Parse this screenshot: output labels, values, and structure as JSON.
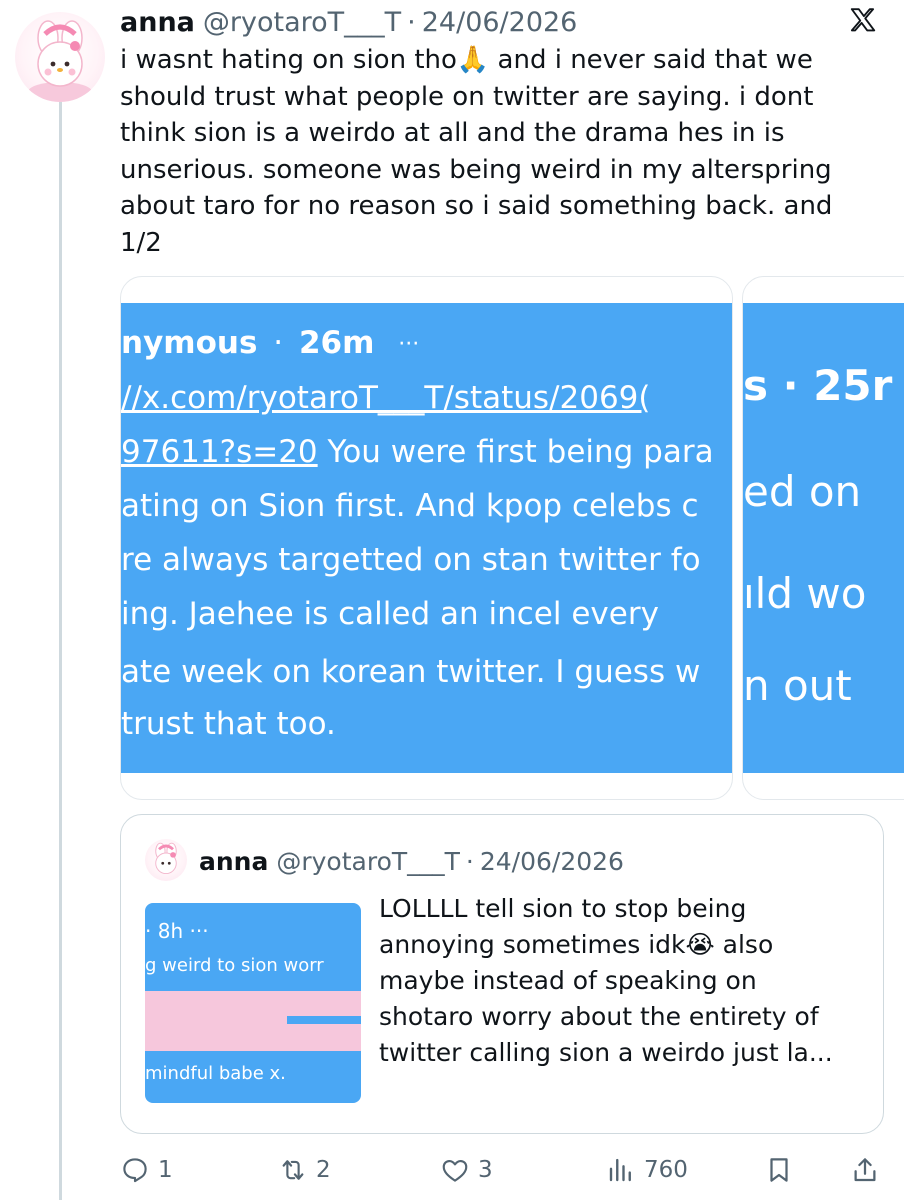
{
  "tweet": {
    "author_name": "anna",
    "handle": "@ryotaroT___T",
    "separator": "·",
    "date": "24/06/2026",
    "text": "i wasnt hating on sion tho🙏 and i never said that we\nshould trust what people on twitter are saying. i dont\nthink sion is a weirdo at all and the drama hes in is\nunserious. someone was being weird in my alterspring\nabout taro for no reason so i said something back. and\n1/2"
  },
  "media": {
    "image1": {
      "header_name": "nymous",
      "header_sep": "·",
      "header_time": "26m",
      "header_more": "···",
      "link_part1": "//x.com/ryotaroT___T/status/2069(",
      "link_part2": "97611?s=20",
      "line2_rest": " You were first being para",
      "line3": "ating on Sion first. And kpop celebs c",
      "line4": "re always targetted on stan twitter fo",
      "line5": "ing. Jaehee is called an incel every",
      "line6": "ate week on korean twitter. I guess w",
      "line7": " trust that too."
    },
    "image2": {
      "line1": "s · 25r",
      "line2": "ed on",
      "line3": "ıld wo",
      "line4": "n out"
    }
  },
  "quote": {
    "author_name": "anna",
    "handle": "@ryotaroT___T",
    "separator": "·",
    "date": "24/06/2026",
    "text": "LOLLLL tell sion to stop being\nannoying sometimes idk😭 also\nmaybe instead of speaking on\nshotaro worry about the entirety of\ntwitter calling sion a weirdo just la...",
    "thumb": {
      "header": "· 8h ···",
      "line1": "g weird to sion worr",
      "line2": "mindful babe x."
    }
  },
  "actions": {
    "replies": "1",
    "reposts": "2",
    "likes": "3",
    "views": "760"
  },
  "icons": {
    "x_logo": "x-logo-icon",
    "reply": "reply-icon",
    "repost": "repost-icon",
    "like": "heart-icon",
    "views": "views-chart-icon",
    "bookmark": "bookmark-icon",
    "share": "share-icon"
  },
  "colors": {
    "screenshot_blue": "#4aa7f4",
    "pink_sticker": "#f6c7dc",
    "secondary_text": "#536471",
    "thread_line": "#cfd9de"
  }
}
